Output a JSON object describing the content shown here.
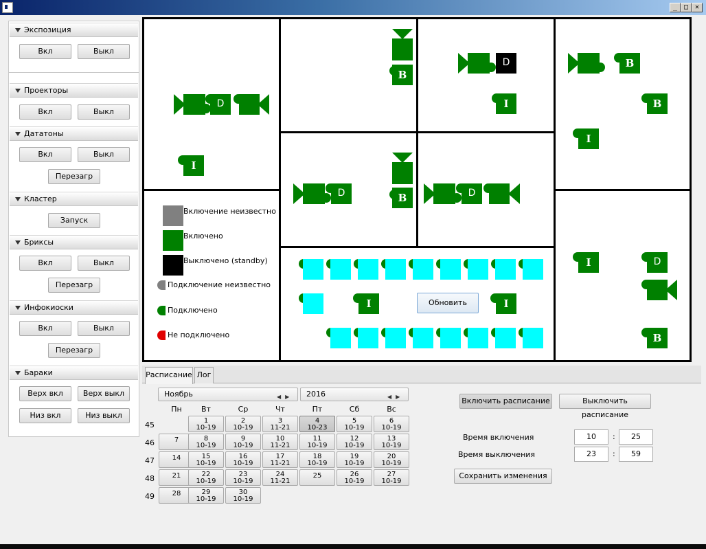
{
  "window": {
    "min_label": "_",
    "max_label": "□",
    "close_label": "✕"
  },
  "groups": {
    "exposition": {
      "title": "Экспозиция",
      "on": "Вкл",
      "off": "Выкл"
    },
    "projectors": {
      "title": "Проекторы",
      "on": "Вкл",
      "off": "Выкл"
    },
    "datatons": {
      "title": "Дататоны",
      "on": "Вкл",
      "off": "Выкл",
      "restart": "Перезагр"
    },
    "cluster": {
      "title": "Кластер",
      "start": "Запуск"
    },
    "brix": {
      "title": "Бриксы",
      "on": "Вкл",
      "off": "Выкл",
      "restart": "Перезагр"
    },
    "kiosks": {
      "title": "Инфокиоски",
      "on": "Вкл",
      "off": "Выкл",
      "restart": "Перезагр"
    },
    "barracks": {
      "title": "Бараки",
      "top_on": "Верх вкл",
      "top_off": "Верх выкл",
      "bottom_on": "Низ вкл",
      "bottom_off": "Низ выкл"
    }
  },
  "map": {
    "labels": {
      "I": "I",
      "B": "B",
      "D": "D"
    },
    "refresh_button": "Обновить",
    "colors": {
      "on": "#008000",
      "off": "#000000",
      "unknown": "#808080",
      "disconnected": "#e00000",
      "screen": "#00ffff"
    }
  },
  "legend": {
    "power_unknown": "Включение неизвестно",
    "power_on": "Включено",
    "power_off": "Выключено (standby)",
    "conn_unknown": "Подключение неизвестно",
    "connected": "Подключено",
    "disconnected": "Не подключено"
  },
  "tabs": {
    "schedule": "Расписание",
    "log": "Лог"
  },
  "calendar": {
    "month": "Ноябрь",
    "year": "2016",
    "weekdays": [
      "Пн",
      "Вт",
      "Ср",
      "Чт",
      "Пт",
      "Сб",
      "Вс"
    ],
    "weeks": [
      "45",
      "46",
      "47",
      "48",
      "49"
    ],
    "days": [
      {
        "d": "1",
        "t": "10-19"
      },
      {
        "d": "2",
        "t": "10-19"
      },
      {
        "d": "3",
        "t": "11-21"
      },
      {
        "d": "4",
        "t": "10-23"
      },
      {
        "d": "5",
        "t": "10-19"
      },
      {
        "d": "6",
        "t": "10-19"
      },
      {
        "d": "7",
        "t": ""
      },
      {
        "d": "8",
        "t": "10-19"
      },
      {
        "d": "9",
        "t": "10-19"
      },
      {
        "d": "10",
        "t": "11-21"
      },
      {
        "d": "11",
        "t": "10-19"
      },
      {
        "d": "12",
        "t": "10-19"
      },
      {
        "d": "13",
        "t": "10-19"
      },
      {
        "d": "14",
        "t": ""
      },
      {
        "d": "15",
        "t": "10-19"
      },
      {
        "d": "16",
        "t": "10-19"
      },
      {
        "d": "17",
        "t": "11-21"
      },
      {
        "d": "18",
        "t": "10-19"
      },
      {
        "d": "19",
        "t": "10-19"
      },
      {
        "d": "20",
        "t": "10-19"
      },
      {
        "d": "21",
        "t": ""
      },
      {
        "d": "22",
        "t": "10-19"
      },
      {
        "d": "23",
        "t": "10-19"
      },
      {
        "d": "24",
        "t": "11-21"
      },
      {
        "d": "25",
        "t": ""
      },
      {
        "d": "26",
        "t": "10-19"
      },
      {
        "d": "27",
        "t": "10-19"
      },
      {
        "d": "28",
        "t": ""
      },
      {
        "d": "29",
        "t": "10-19"
      },
      {
        "d": "30",
        "t": "10-19"
      }
    ]
  },
  "schedule": {
    "enable": "Включить расписание",
    "disable": "Выключить расписание",
    "on_time_label": "Время включения",
    "off_time_label": "Время выключения",
    "on_hour": "10",
    "on_min": "25",
    "off_hour": "23",
    "off_min": "59",
    "colon": ":",
    "save": "Сохранить изменения"
  }
}
